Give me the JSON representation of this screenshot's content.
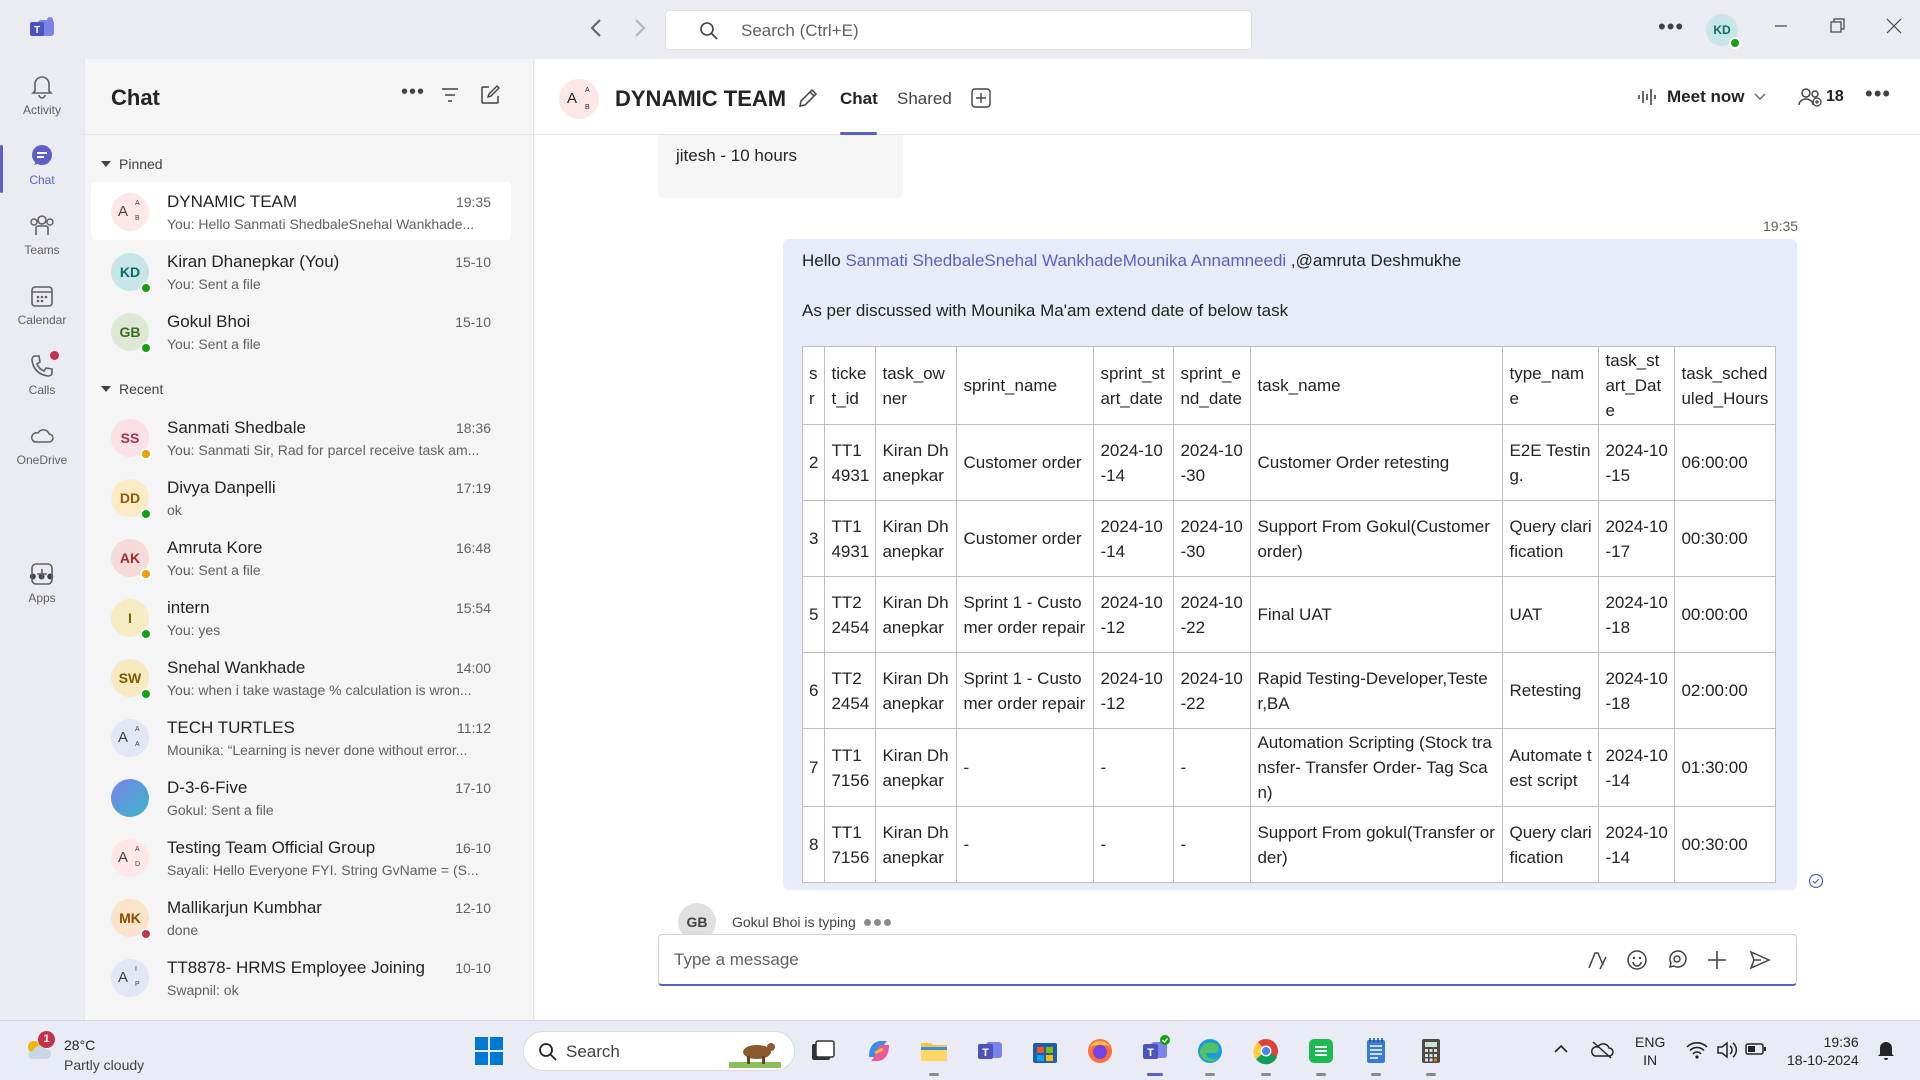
{
  "titlebar": {
    "search_placeholder": "Search (Ctrl+E)",
    "avatar_initials": "KD"
  },
  "rail": {
    "items": [
      {
        "label": "Activity"
      },
      {
        "label": "Chat"
      },
      {
        "label": "Teams"
      },
      {
        "label": "Calendar"
      },
      {
        "label": "Calls"
      },
      {
        "label": "OneDrive"
      },
      {
        "label": "Apps"
      }
    ]
  },
  "chatlist": {
    "title": "Chat",
    "pinned_label": "Pinned",
    "recent_label": "Recent",
    "pinned": [
      {
        "name": "DYNAMIC TEAM",
        "time": "19:35",
        "preview": "You: Hello Sanmati ShedbaleSnehal Wankhade..."
      },
      {
        "name": "Kiran Dhanepkar (You)",
        "time": "15-10",
        "preview": "You: Sent a file",
        "initials": "KD"
      },
      {
        "name": "Gokul Bhoi",
        "time": "15-10",
        "preview": "You: Sent a file",
        "initials": "GB"
      }
    ],
    "recent": [
      {
        "name": "Sanmati Shedbale",
        "time": "18:36",
        "preview": "You: Sanmati Sir, Rad for parcel receive task am...",
        "initials": "SS"
      },
      {
        "name": "Divya Danpelli",
        "time": "17:19",
        "preview": "ok",
        "initials": "DD"
      },
      {
        "name": "Amruta Kore",
        "time": "16:48",
        "preview": "You: Sent a file",
        "initials": "AK"
      },
      {
        "name": "intern",
        "time": "15:54",
        "preview": "You: yes",
        "initials": "I"
      },
      {
        "name": "Snehal Wankhade",
        "time": "14:00",
        "preview": "You: when i take wastage % calculation is wron...",
        "initials": "SW"
      },
      {
        "name": "TECH TURTLES",
        "time": "11:12",
        "preview": "Mounika: “Learning is never done without error..."
      },
      {
        "name": "D-3-6-Five",
        "time": "17-10",
        "preview": "Gokul: Sent a file"
      },
      {
        "name": "Testing Team Official Group",
        "time": "16-10",
        "preview": "Sayali: Hello Everyone FYI.  String GvName = (S..."
      },
      {
        "name": "Mallikarjun Kumbhar",
        "time": "12-10",
        "preview": "done",
        "initials": "MK"
      },
      {
        "name": "TT8878- HRMS Employee Joining",
        "time": "10-10",
        "preview": "Swapnil: ok"
      }
    ]
  },
  "header": {
    "title": "DYNAMIC TEAM",
    "tabs": [
      {
        "label": "Chat"
      },
      {
        "label": "Shared"
      }
    ],
    "meet_now": "Meet now",
    "participants": "18"
  },
  "messages": {
    "previous_text": "jitesh - 10 hours",
    "time": "19:35",
    "greeting": "Hello ",
    "mentions": "Sanmati ShedbaleSnehal WankhadeMounika Annamneedi",
    "mention_tail": " ,@amruta Deshmukhe",
    "line2": "As per discussed with Mounika Ma'am extend date of below task",
    "table": {
      "headers": [
        "sr",
        "ticket_id",
        "task_owner",
        "sprint_name",
        "sprint_start_date",
        "sprint_end_date",
        "task_name",
        "type_name",
        "task_start_Date",
        "task_scheduled_Hours"
      ],
      "rows": [
        [
          "2",
          "TT14931",
          "Kiran Dhanepkar",
          "Customer order",
          "2024-10-14",
          "2024-10-30",
          "Customer Order retesting",
          "E2E Testing.",
          "2024-10-15",
          "06:00:00"
        ],
        [
          "3",
          "TT14931",
          "Kiran Dhanepkar",
          "Customer order",
          "2024-10-14",
          "2024-10-30",
          "Support From Gokul(Customer  order)",
          "Query clarification",
          "2024-10-17",
          "00:30:00"
        ],
        [
          "5",
          "TT22454",
          "Kiran Dhanepkar",
          "Sprint 1 - Customer order  repair",
          "2024-10-12",
          "2024-10-22",
          "Final UAT",
          "UAT",
          "2024-10-18",
          "00:00:00"
        ],
        [
          "6",
          "TT22454",
          "Kiran Dhanepkar",
          "Sprint 1 - Customer order  repair",
          "2024-10-12",
          "2024-10-22",
          "Rapid Testing-Developer,Tester,BA",
          "Retesting",
          "2024-10-18",
          "02:00:00"
        ],
        [
          "7",
          "TT17156",
          "Kiran Dhanepkar",
          "-",
          "-",
          "-",
          "Automation Scripting (Stock transfer- Transfer Order- Tag Scan)",
          "Automate test script",
          "2024-10-14",
          "01:30:00"
        ],
        [
          "8",
          "TT17156",
          "Kiran Dhanepkar",
          "-",
          "-",
          "-",
          "Support From gokul(Transfer order)",
          "Query clarification",
          "2024-10-14",
          "00:30:00"
        ]
      ]
    },
    "typing_initials": "GB",
    "typing_text": "Gokul Bhoi is typing"
  },
  "composer": {
    "placeholder": "Type a message"
  },
  "taskbar": {
    "weather_badge": "1",
    "temperature": "28°C",
    "weather_desc": "Partly cloudy",
    "search_label": "Search",
    "lang_line1": "ENG",
    "lang_line2": "IN",
    "time": "19:36",
    "date": "18-10-2024"
  },
  "colors": {
    "accent": "#5b5fc7",
    "bubble": "#e8ebfa",
    "presence_available": "#13a10e",
    "presence_away": "#eaa300",
    "presence_busy": "#c4314b"
  }
}
